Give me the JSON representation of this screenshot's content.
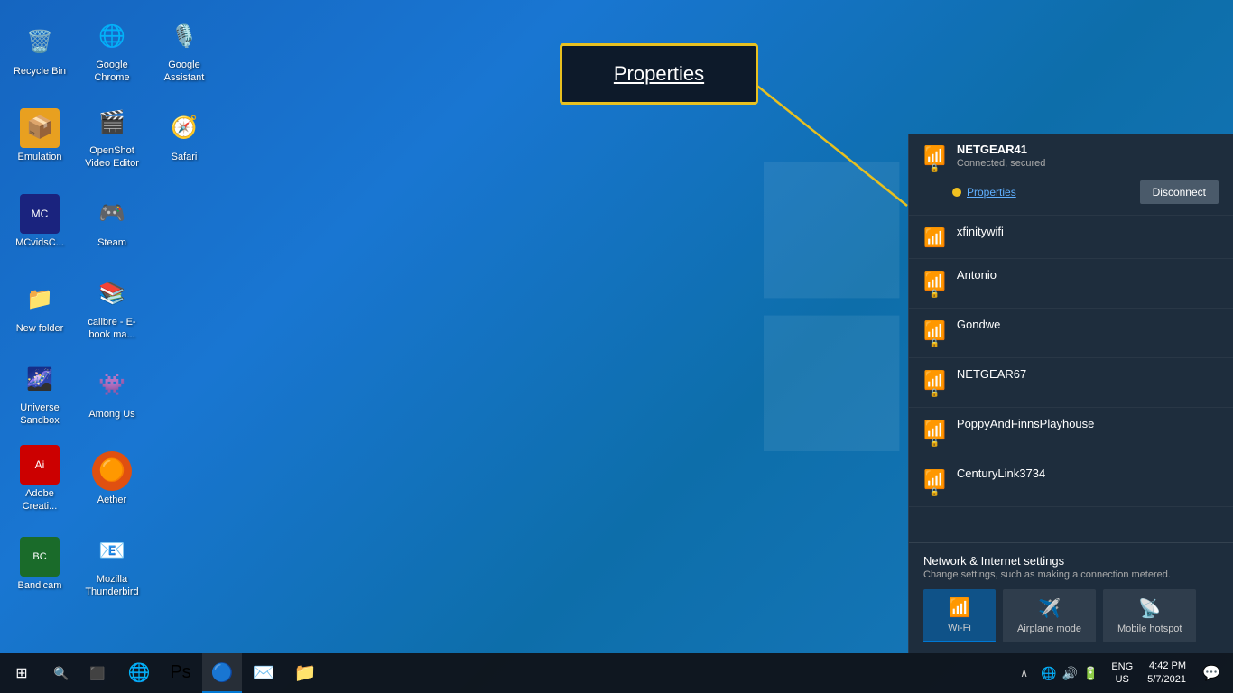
{
  "desktop": {
    "icons": [
      {
        "id": "recycle-bin",
        "label": "Recycle Bin",
        "emoji": "🗑️",
        "col": 0
      },
      {
        "id": "google-chrome",
        "label": "Google Chrome",
        "emoji": "🌐",
        "col": 1
      },
      {
        "id": "google-assistant",
        "label": "Google Assistant",
        "emoji": "🔵",
        "col": 2
      },
      {
        "id": "emulation",
        "label": "Emulation",
        "emoji": "📦",
        "col": 0
      },
      {
        "id": "openshot",
        "label": "OpenShot Video Editor",
        "emoji": "🎬",
        "col": 1
      },
      {
        "id": "safari",
        "label": "Safari",
        "emoji": "🧭",
        "col": 2
      },
      {
        "id": "mcvids",
        "label": "MCvidsC...",
        "emoji": "📺",
        "col": 0
      },
      {
        "id": "steam",
        "label": "Steam",
        "emoji": "🎮",
        "col": 1
      },
      {
        "id": "newfolder",
        "label": "New folder",
        "emoji": "📁",
        "col": 0
      },
      {
        "id": "calibre",
        "label": "calibre - E-book ma...",
        "emoji": "📚",
        "col": 1
      },
      {
        "id": "universe",
        "label": "Universe Sandbox",
        "emoji": "🌌",
        "col": 0
      },
      {
        "id": "among-us",
        "label": "Among Us",
        "emoji": "👾",
        "col": 1
      },
      {
        "id": "adobe",
        "label": "Adobe Creati...",
        "emoji": "🎨",
        "col": 0
      },
      {
        "id": "aether",
        "label": "Aether",
        "emoji": "🟠",
        "col": 1
      },
      {
        "id": "bandicam",
        "label": "Bandicam",
        "emoji": "🎥",
        "col": 0
      },
      {
        "id": "thunderbird",
        "label": "Mozilla Thunderbird",
        "emoji": "🦅",
        "col": 1
      }
    ]
  },
  "properties_callout": {
    "label": "Properties"
  },
  "wifi_panel": {
    "connected_network": {
      "name": "NETGEAR41",
      "status": "Connected, secured"
    },
    "properties_link": "Properties",
    "disconnect_button": "Disconnect",
    "networks": [
      {
        "name": "xfinitywifi",
        "secured": false
      },
      {
        "name": "Antonio",
        "secured": true
      },
      {
        "name": "Gondwe",
        "secured": true
      },
      {
        "name": "NETGEAR67",
        "secured": true
      },
      {
        "name": "PoppyAndFinnsPlayhouse",
        "secured": true
      },
      {
        "name": "CenturyLink3734",
        "secured": true
      }
    ],
    "footer": {
      "settings_label": "Network & Internet settings",
      "settings_sub": "Change settings, such as making a connection metered.",
      "buttons": [
        {
          "id": "wifi",
          "label": "Wi-Fi",
          "active": true
        },
        {
          "id": "airplane",
          "label": "Airplane mode",
          "active": false
        },
        {
          "id": "hotspot",
          "label": "Mobile hotspot",
          "active": false
        }
      ]
    }
  },
  "taskbar": {
    "time": "4:42 PM",
    "date": "5/7/2021",
    "lang_top": "ENG",
    "lang_bot": "US"
  }
}
